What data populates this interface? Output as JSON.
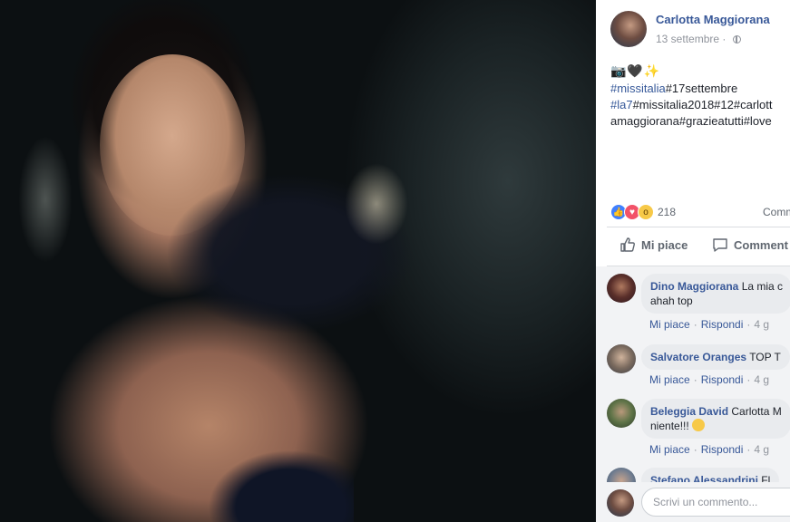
{
  "post": {
    "author": "Carlotta Maggiorana",
    "date": "13 settembre",
    "privacy_icon": "globe-icon",
    "emoji_line": "📷🖤✨",
    "caption_lines": [
      {
        "prefix": "",
        "link": "#missitalia",
        "text": "#17settembre"
      },
      {
        "prefix": "",
        "link": "#la7",
        "text": "#missitalia2018#12#carlott"
      },
      {
        "prefix": "",
        "link": "",
        "text": "amaggiorana#grazieatutti#love"
      }
    ],
    "reactions_count": "218",
    "comments_label": "Comm",
    "like_action": "Mi piace",
    "comment_action": "Comment"
  },
  "comments": [
    {
      "name": "Dino Maggiorana",
      "text": "La mia c",
      "text2": "ahah top",
      "like": "Mi piace",
      "reply": "Rispondi",
      "time": "4 g"
    },
    {
      "name": "Salvatore Oranges",
      "text": "TOP T",
      "like": "Mi piace",
      "reply": "Rispondi",
      "time": "4 g"
    },
    {
      "name": "Beleggia David",
      "text": "Carlotta M",
      "text2": "niente!!!",
      "like": "Mi piace",
      "reply": "Rispondi",
      "time": "4 g"
    },
    {
      "name": "Stefano Alessandrini",
      "text": "Fl"
    }
  ],
  "composer": {
    "placeholder": "Scrivi un commento..."
  },
  "colors": {
    "link": "#385898",
    "meta": "#90949c",
    "like_blue": "#4080ff",
    "love_red": "#f25268"
  }
}
